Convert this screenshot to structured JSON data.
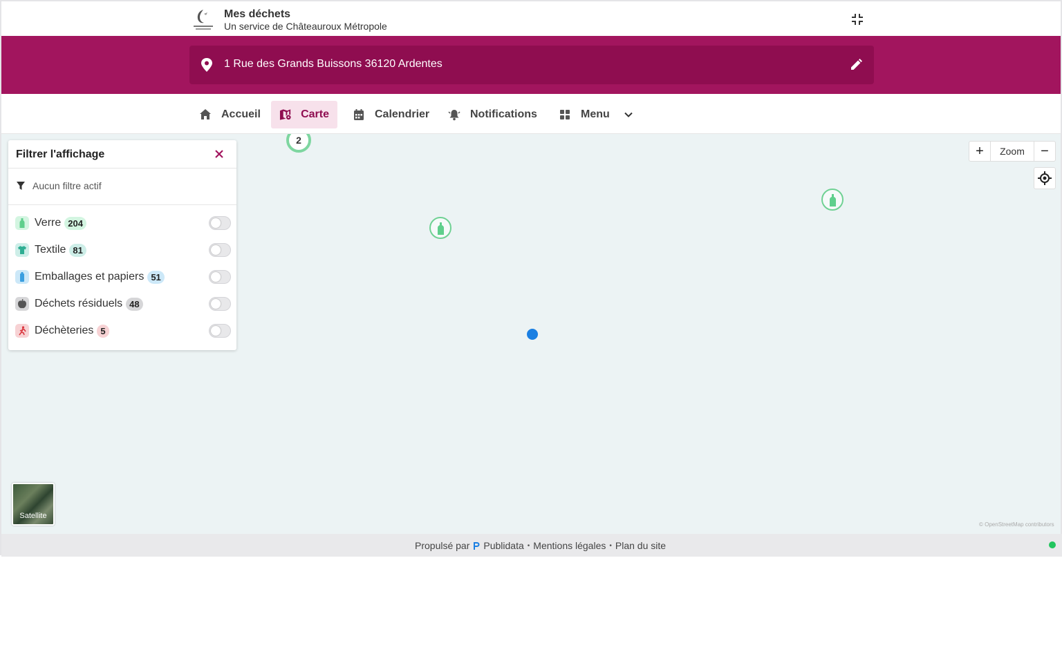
{
  "header": {
    "title": "Mes déchets",
    "subtitle": "Un service de Châteauroux Métropole"
  },
  "address": {
    "text": "1 Rue des Grands Buissons 36120 Ardentes"
  },
  "nav": {
    "items": [
      {
        "label": "Accueil",
        "icon": "home-icon"
      },
      {
        "label": "Carte",
        "icon": "map-pin-icon",
        "active": true
      },
      {
        "label": "Calendrier",
        "icon": "calendar-icon"
      },
      {
        "label": "Notifications",
        "icon": "bell-icon"
      },
      {
        "label": "Menu",
        "icon": "grid-icon"
      }
    ]
  },
  "map": {
    "cluster_count": "2",
    "zoom_label": "Zoom",
    "zoom_in": "+",
    "zoom_out": "−",
    "satellite_label": "Satellite",
    "attribution": "© OpenStreetMap contributors"
  },
  "filter_panel": {
    "title": "Filtrer l'affichage",
    "status": "Aucun filtre actif",
    "categories": [
      {
        "label": "Verre",
        "count": "204",
        "color": "#d3f5e1",
        "icon_color": "#5fcf8c",
        "icon": "bottle-icon",
        "enabled": false
      },
      {
        "label": "Textile",
        "count": "81",
        "color": "#cdeee8",
        "icon_color": "#2fae93",
        "icon": "tshirt-icon",
        "enabled": false
      },
      {
        "label": "Emballages et papiers",
        "count": "51",
        "color": "#cce8f8",
        "icon_color": "#3b9fe0",
        "icon": "packaging-icon",
        "enabled": false
      },
      {
        "label": "Déchets résiduels",
        "count": "48",
        "color": "#d6d6d8",
        "icon_color": "#555555",
        "icon": "apple-core-icon",
        "enabled": false
      },
      {
        "label": "Déchèteries",
        "count": "5",
        "color": "#f7d2d4",
        "icon_color": "#d9363e",
        "icon": "recycling-center-icon",
        "enabled": false
      }
    ]
  },
  "footer": {
    "powered_by": "Propulsé par",
    "brand": "Publidata",
    "legal": "Mentions légales",
    "sitemap": "Plan du site",
    "separator": "•"
  },
  "colors": {
    "brand": "#a2155e",
    "brand_dark": "#8f0d50",
    "active_nav_bg": "#f7e1eb",
    "status_online": "#22c55e"
  }
}
